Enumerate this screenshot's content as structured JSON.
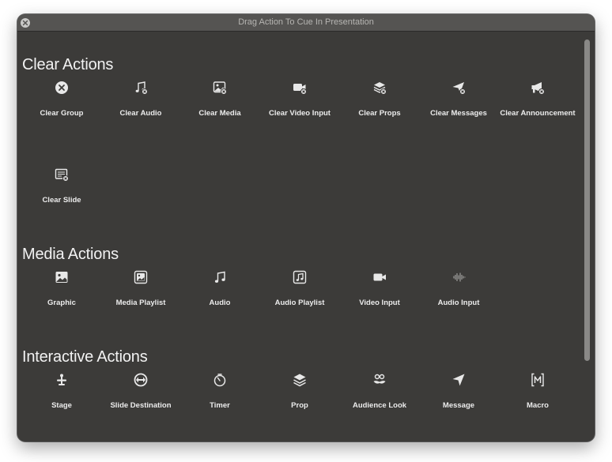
{
  "window": {
    "title": "Drag Action To Cue In Presentation"
  },
  "sections": {
    "clear": {
      "title": "Clear Actions",
      "items": [
        {
          "label": "Clear Group",
          "icon": "x-circle-icon"
        },
        {
          "label": "Clear Audio",
          "icon": "music-note-x-icon"
        },
        {
          "label": "Clear Media",
          "icon": "image-x-icon"
        },
        {
          "label": "Clear Video Input",
          "icon": "video-camera-x-icon"
        },
        {
          "label": "Clear Props",
          "icon": "layers-x-icon"
        },
        {
          "label": "Clear Messages",
          "icon": "paper-plane-x-icon"
        },
        {
          "label": "Clear Announcement",
          "icon": "megaphone-x-icon"
        },
        {
          "label": "Clear Slide",
          "icon": "slide-x-icon"
        }
      ]
    },
    "media": {
      "title": "Media Actions",
      "items": [
        {
          "label": "Graphic",
          "icon": "image-icon"
        },
        {
          "label": "Media Playlist",
          "icon": "media-playlist-icon"
        },
        {
          "label": "Audio",
          "icon": "music-note-icon"
        },
        {
          "label": "Audio Playlist",
          "icon": "audio-playlist-icon"
        },
        {
          "label": "Video Input",
          "icon": "video-camera-icon"
        },
        {
          "label": "Audio Input",
          "icon": "waveform-icon"
        }
      ]
    },
    "interactive": {
      "title": "Interactive Actions",
      "items": [
        {
          "label": "Stage",
          "icon": "stage-icon"
        },
        {
          "label": "Slide Destination",
          "icon": "slide-destination-icon"
        },
        {
          "label": "Timer",
          "icon": "timer-icon"
        },
        {
          "label": "Prop",
          "icon": "layers-icon"
        },
        {
          "label": "Audience Look",
          "icon": "audience-look-icon"
        },
        {
          "label": "Message",
          "icon": "paper-plane-icon"
        },
        {
          "label": "Macro",
          "icon": "macro-icon"
        }
      ]
    }
  }
}
